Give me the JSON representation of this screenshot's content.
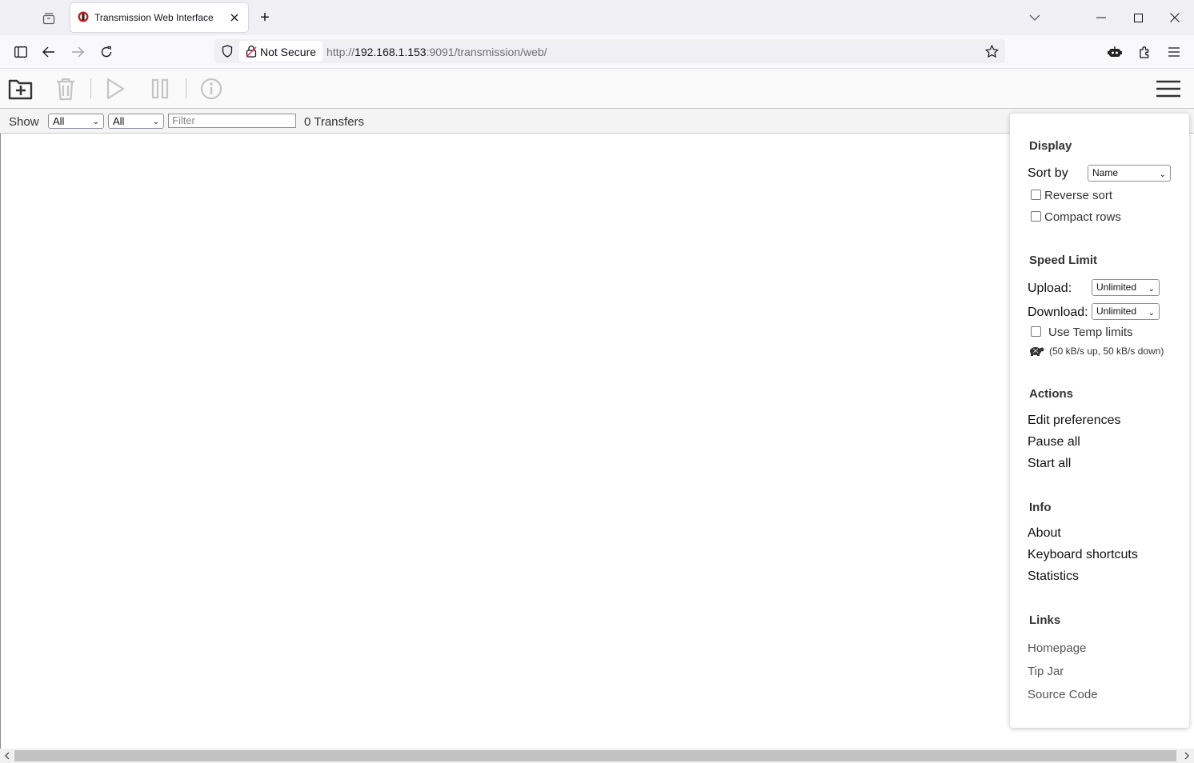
{
  "browser": {
    "tab_title": "Transmission Web Interface",
    "new_tab": "+",
    "not_secure": "Not Secure",
    "url_prefix": "http://",
    "url_host": "192.168.1.153",
    "url_rest": ":9091/transmission/web/"
  },
  "filterbar": {
    "show_label": "Show",
    "state_filter": "All",
    "tracker_filter": "All",
    "filter_placeholder": "Filter",
    "transfers": "0 Transfers"
  },
  "menu": {
    "display_heading": "Display",
    "sort_by_label": "Sort by",
    "sort_by_value": "Name",
    "reverse_sort": "Reverse sort",
    "compact_rows": "Compact rows",
    "speed_heading": "Speed Limit",
    "upload_label": "Upload:",
    "upload_value": "Unlimited",
    "download_label": "Download:",
    "download_value": "Unlimited",
    "temp_limits": "Use Temp limits",
    "temp_limits_detail": "(50 kB/s up, 50 kB/s down)",
    "actions_heading": "Actions",
    "edit_preferences": "Edit preferences",
    "pause_all": "Pause all",
    "start_all": "Start all",
    "info_heading": "Info",
    "about": "About",
    "keyboard_shortcuts": "Keyboard shortcuts",
    "statistics": "Statistics",
    "links_heading": "Links",
    "homepage": "Homepage",
    "tip_jar": "Tip Jar",
    "source_code": "Source Code"
  }
}
